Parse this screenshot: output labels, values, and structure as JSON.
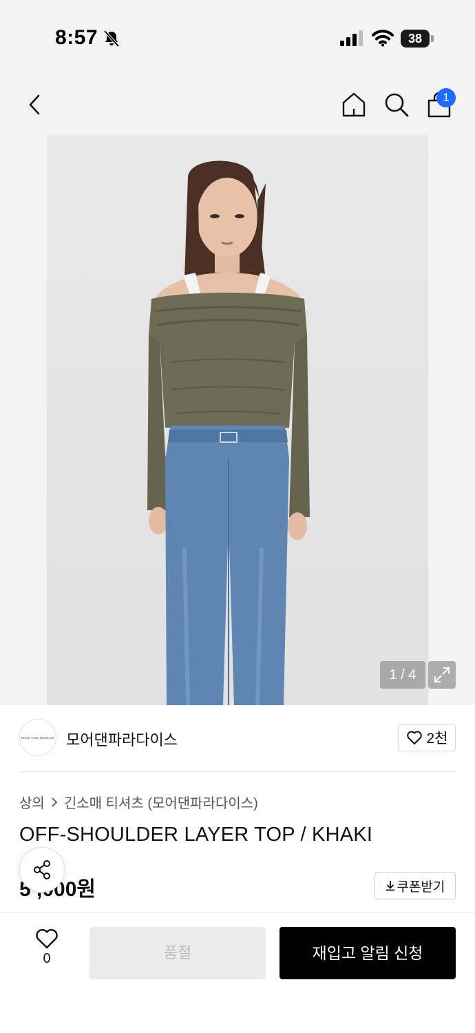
{
  "status_bar": {
    "time": "8:57",
    "battery": "38",
    "battery_level": 0.38
  },
  "header": {
    "cart_badge": "1"
  },
  "image": {
    "counter": "1 / 4"
  },
  "brand": {
    "logo_text": "MORE THAN PARADISE",
    "name": "모어댄파라다이스",
    "likes": "2천"
  },
  "product": {
    "breadcrumb": [
      "상의",
      "긴소매 티셔츠 (모어댄파라다이스)"
    ],
    "title": "OFF-SHOULDER LAYER TOP / KHAKI",
    "price": "5 ,000원",
    "coupon_label": "쿠폰받기"
  },
  "bottom_bar": {
    "wish_count": "0",
    "soldout_label": "품절",
    "restock_label": "재입고 알림 신청"
  },
  "colors": {
    "badge": "#1f6bff",
    "primary_button": "#000000",
    "disabled_button": "#ececec",
    "top_background": "#f3f3f3"
  },
  "icons": [
    "bell-off-icon",
    "signal-icon",
    "wifi-icon",
    "battery-icon",
    "back-icon",
    "home-icon",
    "search-icon",
    "shopping-bag-icon",
    "expand-icon",
    "heart-icon",
    "share-icon",
    "download-icon"
  ]
}
